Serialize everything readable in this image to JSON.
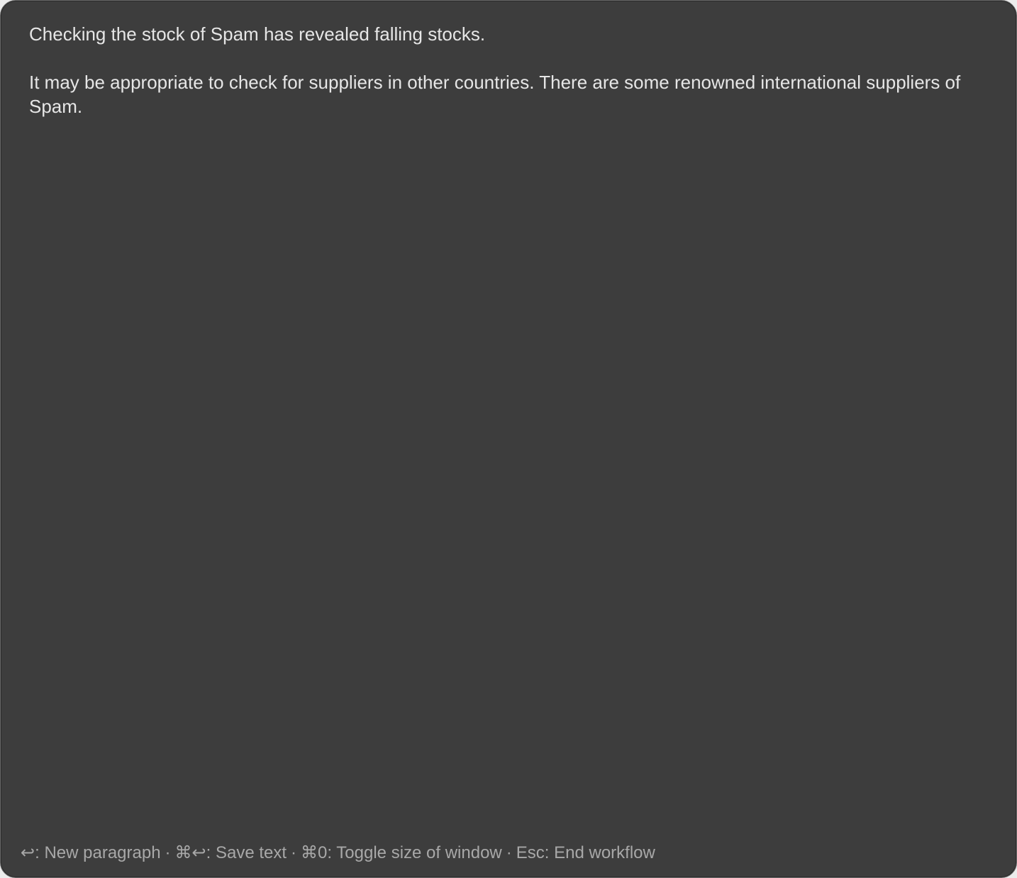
{
  "editor": {
    "paragraphs": [
      "Checking the stock of Spam has revealed falling stocks.",
      "It may be appropriate to check for suppliers in other countries. There are some renowned international suppliers of Spam."
    ]
  },
  "footer": {
    "hints": [
      "↩: New paragraph",
      "⌘↩: Save text",
      "⌘0: Toggle size of window",
      "Esc: End workflow"
    ],
    "separator": "·"
  }
}
